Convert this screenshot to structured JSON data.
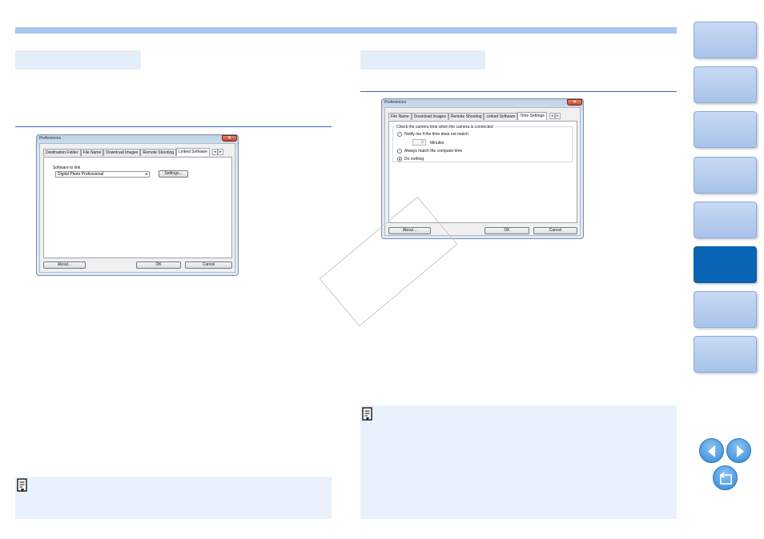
{
  "left_dialog": {
    "title": "Preferences",
    "tabs": [
      "Destination Folder",
      "File Name",
      "Download Images",
      "Remote Shooting",
      "Linked Software"
    ],
    "active_tab": "Linked Software",
    "software_label": "Software to link",
    "software_value": "Digital Photo Professional",
    "settings_button": "Settings...",
    "about_button": "About...",
    "ok_button": "OK",
    "cancel_button": "Cancel"
  },
  "right_dialog": {
    "title": "Preferences",
    "tabs": [
      "File Name",
      "Download Images",
      "Remote Shooting",
      "Linked Software",
      "Time Settings"
    ],
    "active_tab": "Time Settings",
    "group_label": "Check the camera time when the camera is connected",
    "option_notify": "Notify me if the time does not match",
    "minutes_value": "5",
    "minutes_label": "Minutes",
    "option_always": "Always match the computer time",
    "option_nothing": "Do nothing",
    "selected_option": "Do nothing",
    "about_button": "About...",
    "ok_button": "OK",
    "cancel_button": "Cancel"
  },
  "colors": {
    "accent_bar": "#a9c7ee",
    "rule": "#3a66b0",
    "note_bg": "#e8f1fc",
    "nav_active": "#0a64b5",
    "nav_inactive": "#b6cdef"
  },
  "nav": {
    "active_index": 5,
    "icons": [
      "prev-page-icon",
      "next-page-icon",
      "return-icon"
    ]
  }
}
